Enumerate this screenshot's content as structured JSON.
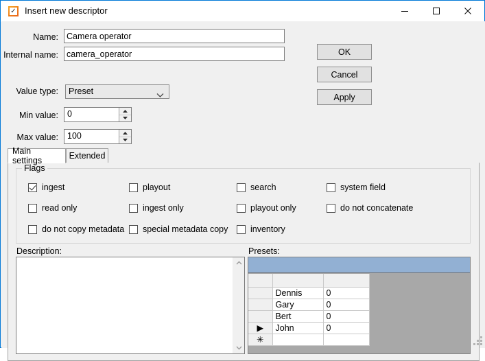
{
  "window": {
    "title": "Insert new descriptor",
    "icon": "checkbox-app-icon",
    "accent_color": "#0078d7",
    "controls": {
      "minimize": "minimize-icon",
      "maximize": "maximize-icon",
      "close": "close-icon"
    }
  },
  "form": {
    "name": {
      "label": "Name:",
      "value": "Camera operator",
      "placeholder": ""
    },
    "internal_name": {
      "label": "Internal name:",
      "value": "camera_operator",
      "placeholder": ""
    },
    "value_type": {
      "label": "Value type:",
      "value": "Preset",
      "options": [
        "Preset"
      ]
    },
    "min_value": {
      "label": "Min value:",
      "value": "0"
    },
    "max_value": {
      "label": "Max value:",
      "value": "100"
    }
  },
  "buttons": {
    "ok": "OK",
    "cancel": "Cancel",
    "apply": "Apply"
  },
  "tabs": [
    {
      "label": "Main settings",
      "active": true
    },
    {
      "label": "Extended",
      "active": false
    }
  ],
  "flags": {
    "title": "Flags",
    "items": [
      {
        "label": "ingest",
        "checked": true
      },
      {
        "label": "playout",
        "checked": false
      },
      {
        "label": "search",
        "checked": false
      },
      {
        "label": "system field",
        "checked": false
      },
      {
        "label": "read only",
        "checked": false
      },
      {
        "label": "ingest only",
        "checked": false
      },
      {
        "label": "playout only",
        "checked": false
      },
      {
        "label": "do not concatenate",
        "checked": false
      },
      {
        "label": "do not copy metadata",
        "checked": false
      },
      {
        "label": "special metadata copy",
        "checked": false
      },
      {
        "label": "inventory",
        "checked": false
      }
    ]
  },
  "description": {
    "label": "Description:",
    "value": "",
    "placeholder": ""
  },
  "presets": {
    "label": "Presets:",
    "columns": [
      "",
      "",
      ""
    ],
    "rows": [
      {
        "marker": "",
        "name": "Dennis",
        "value": "0"
      },
      {
        "marker": "",
        "name": "Gary",
        "value": "0"
      },
      {
        "marker": "",
        "name": "Bert",
        "value": "0"
      },
      {
        "marker": "▶",
        "name": "John",
        "value": "0"
      },
      {
        "marker": "✳",
        "name": "",
        "value": ""
      }
    ]
  }
}
